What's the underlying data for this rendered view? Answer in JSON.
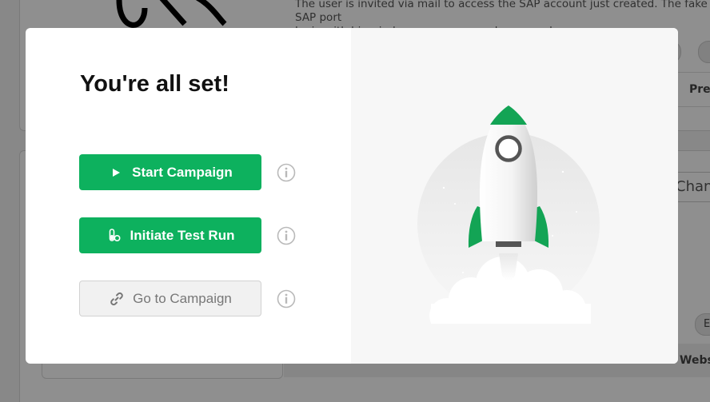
{
  "background": {
    "description_text": "The user is invited via mail to access the SAP account just created. The fake SAP port\nlogin with his windows username and password.",
    "chip_left": "g",
    "chip_right": "",
    "column_header": "Prev",
    "input_value": "Chang",
    "chip_lower": "E",
    "column_label": "Websi"
  },
  "modal": {
    "title": "You're all set!",
    "actions": [
      {
        "label": "Start Campaign",
        "icon": "play-icon",
        "style": "primary"
      },
      {
        "label": "Initiate Test Run",
        "icon": "test-tube-icon",
        "style": "primary"
      },
      {
        "label": "Go to Campaign",
        "icon": "link-icon",
        "style": "secondary"
      }
    ],
    "info_icon": "info-icon",
    "illustration": "rocket-launch-illustration"
  },
  "colors": {
    "primary": "#0db15e",
    "secondary_bg": "#f1f1f1",
    "overlay_dim": "#8a8a8a",
    "rocket_green": "#13a455"
  }
}
